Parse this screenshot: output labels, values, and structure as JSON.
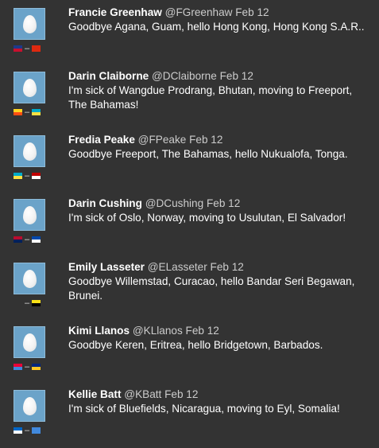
{
  "tweets": [
    {
      "name": "Francie Greenhaw",
      "handle": "@FGreenhaw",
      "date": "Feb 12",
      "text": "Goodbye Agana, Guam, hello Hong Kong, Hong Kong S.A.R..",
      "flag_from": "Guam",
      "flag_to": "Hong Kong",
      "flag_from_colors": [
        "#1e3a8a",
        "#c8102e"
      ],
      "flag_to_colors": [
        "#de2910",
        "#de2910"
      ]
    },
    {
      "name": "Darin Claiborne",
      "handle": "@DClaiborne",
      "date": "Feb 12",
      "text": "I'm sick of Wangdue Prodrang, Bhutan, moving to Freeport, The Bahamas!",
      "flag_from": "Bhutan",
      "flag_to": "The Bahamas",
      "flag_from_colors": [
        "#ffd520",
        "#ff4e12"
      ],
      "flag_to_colors": [
        "#00abc9",
        "#fae042"
      ]
    },
    {
      "name": "Fredia Peake",
      "handle": "@FPeake",
      "date": "Feb 12",
      "text": "Goodbye Freeport, The Bahamas, hello Nukualofa, Tonga.",
      "flag_from": "The Bahamas",
      "flag_to": "Tonga",
      "flag_from_colors": [
        "#00abc9",
        "#fae042"
      ],
      "flag_to_colors": [
        "#c10000",
        "#ffffff"
      ]
    },
    {
      "name": "Darin Cushing",
      "handle": "@DCushing",
      "date": "Feb 12",
      "text": "I'm sick of Oslo, Norway, moving to Usulutan, El Salvador!",
      "flag_from": "Norway",
      "flag_to": "El Salvador",
      "flag_from_colors": [
        "#ba0c2f",
        "#00205b"
      ],
      "flag_to_colors": [
        "#0047ab",
        "#ffffff"
      ]
    },
    {
      "name": "Emily Lasseter",
      "handle": "@ELasseter",
      "date": "Feb 12",
      "text": "Goodbye Willemstad, Curacao, hello Bandar Seri Begawan, Brunei.",
      "flag_from": "",
      "flag_to": "Brunei",
      "flag_from_colors": [
        "",
        ""
      ],
      "flag_to_colors": [
        "#f7e017",
        "#000000"
      ]
    },
    {
      "name": "Kimi Llanos",
      "handle": "@KLlanos",
      "date": "Feb 12",
      "text": "Goodbye Keren, Eritrea, hello Bridgetown, Barbados.",
      "flag_from": "Eritrea",
      "flag_to": "Barbados",
      "flag_from_colors": [
        "#ea0437",
        "#4189dd"
      ],
      "flag_to_colors": [
        "#00267f",
        "#ffc726"
      ]
    },
    {
      "name": "Kellie Batt",
      "handle": "@KBatt",
      "date": "Feb 12",
      "text": "I'm sick of Bluefields, Nicaragua, moving to Eyl, Somalia!",
      "flag_from": "Nicaragua",
      "flag_to": "Somalia",
      "flag_from_colors": [
        "#0067c6",
        "#ffffff"
      ],
      "flag_to_colors": [
        "#4189dd",
        "#4189dd"
      ]
    }
  ],
  "separator": "–"
}
